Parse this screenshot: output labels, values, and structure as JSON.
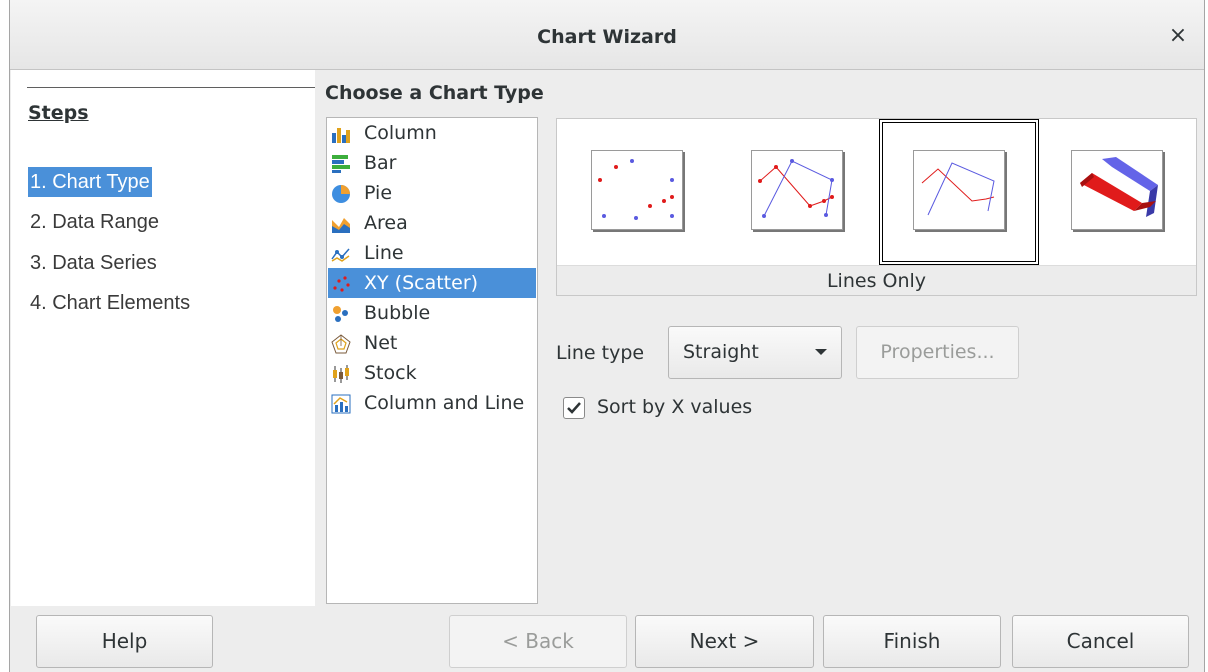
{
  "window": {
    "title": "Chart Wizard",
    "close_glyph": "×"
  },
  "steps": {
    "heading": "Steps",
    "items": [
      {
        "label": "1. Chart Type",
        "active": true
      },
      {
        "label": "2. Data Range",
        "active": false
      },
      {
        "label": "3. Data Series",
        "active": false
      },
      {
        "label": "4. Chart Elements",
        "active": false
      }
    ]
  },
  "main": {
    "heading": "Choose a Chart Type",
    "chart_types": [
      {
        "label": "Column",
        "icon": "column-chart-icon"
      },
      {
        "label": "Bar",
        "icon": "bar-chart-icon"
      },
      {
        "label": "Pie",
        "icon": "pie-chart-icon"
      },
      {
        "label": "Area",
        "icon": "area-chart-icon"
      },
      {
        "label": "Line",
        "icon": "line-chart-icon"
      },
      {
        "label": "XY (Scatter)",
        "icon": "scatter-chart-icon",
        "selected": true
      },
      {
        "label": "Bubble",
        "icon": "bubble-chart-icon"
      },
      {
        "label": "Net",
        "icon": "net-chart-icon"
      },
      {
        "label": "Stock",
        "icon": "stock-chart-icon"
      },
      {
        "label": "Column and Line",
        "icon": "column-line-chart-icon"
      }
    ],
    "variants": [
      {
        "icon": "points-only-icon"
      },
      {
        "icon": "points-and-lines-icon"
      },
      {
        "icon": "lines-only-icon",
        "selected": true
      },
      {
        "icon": "3d-lines-icon"
      }
    ],
    "selected_variant_label": "Lines Only",
    "line_type_label": "Line type",
    "line_type_value": "Straight",
    "properties_label": "Properties...",
    "sort_label": "Sort by X values",
    "sort_checked": true
  },
  "footer": {
    "help": "Help",
    "back": "< Back",
    "next": "Next >",
    "finish": "Finish",
    "cancel": "Cancel"
  },
  "colors": {
    "selection": "#4a90d9",
    "series_red": "#e01b1b",
    "series_blue": "#5a5ae0"
  }
}
